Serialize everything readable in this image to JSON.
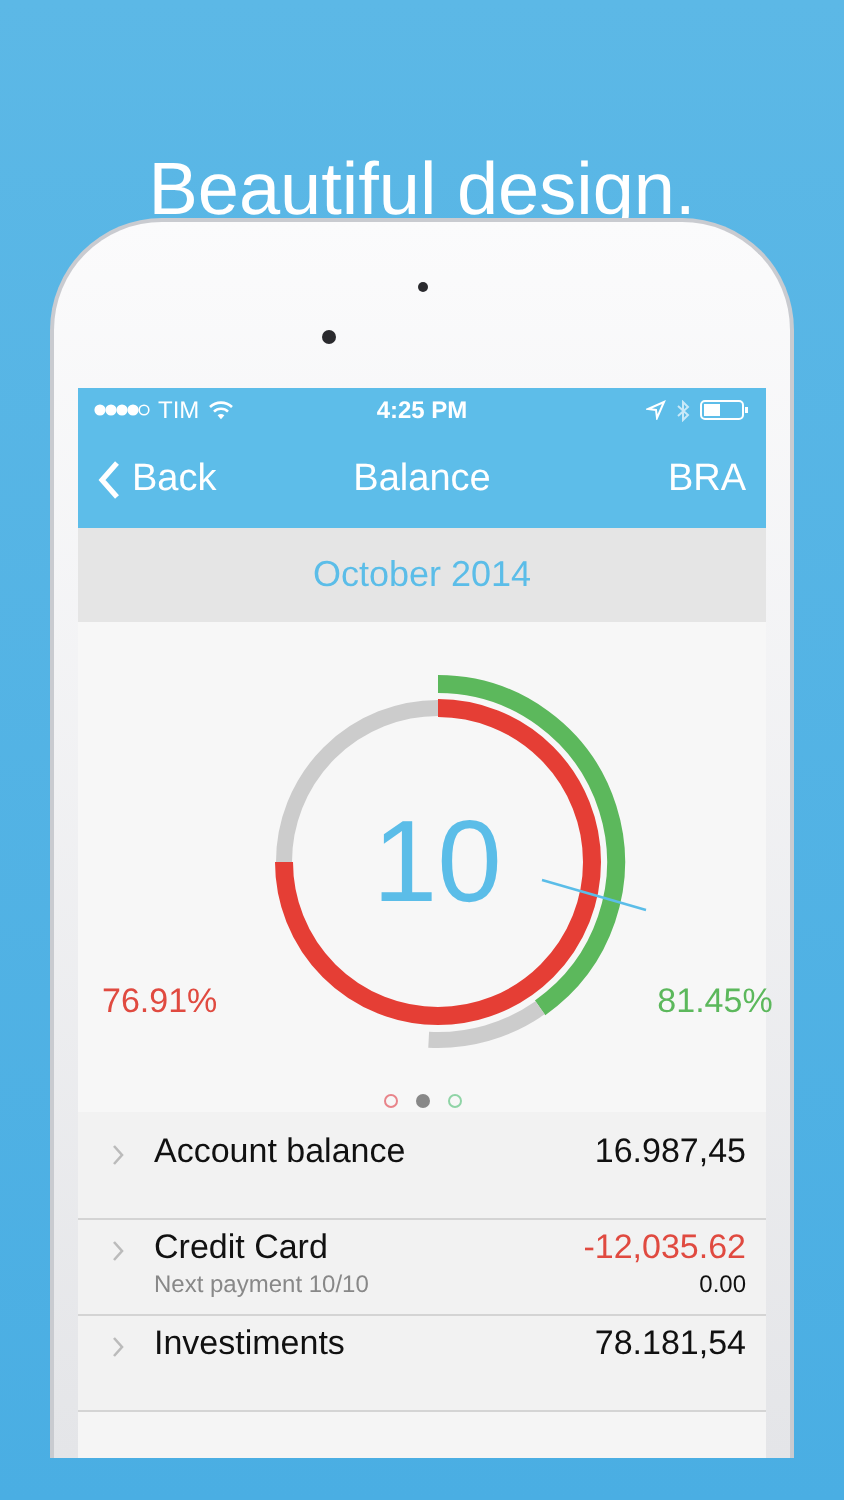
{
  "headline": "Beautiful design.",
  "status_bar": {
    "carrier": "TIM",
    "time": "4:25 PM"
  },
  "nav": {
    "back": "Back",
    "title": "Balance",
    "action": "BRA"
  },
  "month": "October 2014",
  "summary": {
    "center": "10",
    "left_percent": "76.91%",
    "right_percent": "81.45%"
  },
  "pages": [
    {
      "selected": false,
      "color": "#e8848a"
    },
    {
      "selected": true,
      "color": "#888888"
    },
    {
      "selected": false,
      "color": "#8fd4a6"
    }
  ],
  "rows": [
    {
      "label": "Account balance",
      "value": "16.987,45",
      "negative": false
    },
    {
      "label": "Credit Card",
      "value": "-12,035.62",
      "negative": true,
      "note": "Next payment 10/10",
      "sub_value": "0.00"
    },
    {
      "label": "Investiments",
      "value": "78.181,54",
      "negative": false
    }
  ]
}
